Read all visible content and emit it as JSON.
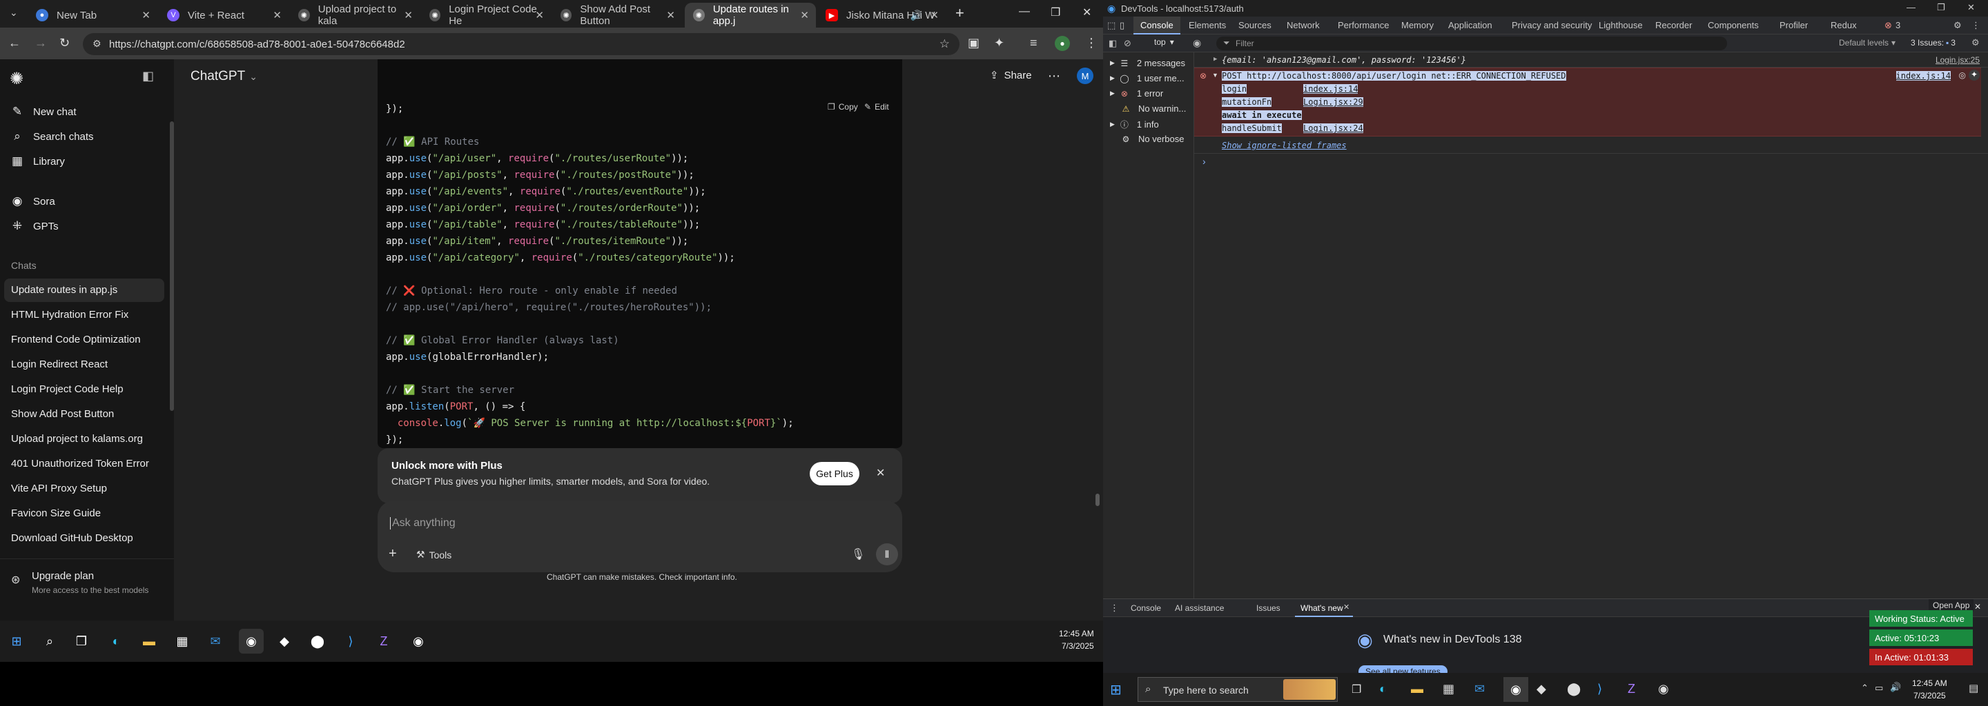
{
  "browser": {
    "tabs": [
      {
        "title": "New Tab",
        "fav": "chrome"
      },
      {
        "title": "Vite + React",
        "fav": "vite"
      },
      {
        "title": "Upload project to kala",
        "fav": "chatgpt"
      },
      {
        "title": "Login Project Code He",
        "fav": "chatgpt"
      },
      {
        "title": "Show Add Post Button",
        "fav": "chatgpt"
      },
      {
        "title": "Update routes in app.j",
        "fav": "chatgpt"
      },
      {
        "title": "Jisko Mitana Hai W",
        "fav": "youtube"
      }
    ],
    "new_tab": "+",
    "url": "https://chatgpt.com/c/68658508-ad78-8001-a0e1-50478c6648d2"
  },
  "sidebar": {
    "new_chat": "New chat",
    "search_chats": "Search chats",
    "library": "Library",
    "sora": "Sora",
    "gpts": "GPTs",
    "chats_heading": "Chats",
    "chats": [
      "Update routes in app.js",
      "HTML Hydration Error Fix",
      "Frontend Code Optimization",
      "Login Redirect React",
      "Login Project Code Help",
      "Show Add Post Button",
      "Upload project to kalams.org",
      "401 Unauthorized Token Error",
      "Vite API Proxy Setup",
      "Favicon Size Guide",
      "Download GitHub Desktop"
    ],
    "upgrade_title": "Upgrade plan",
    "upgrade_sub": "More access to the best models"
  },
  "header": {
    "model": "ChatGPT",
    "share": "Share",
    "avatar": "M"
  },
  "code": {
    "copy": "Copy",
    "edit": "Edit",
    "lines": [
      "});",
      "",
      "// ✅ API Routes",
      "app.use(\"/api/user\", require(\"./routes/userRoute\"));",
      "app.use(\"/api/posts\", require(\"./routes/postRoute\"));",
      "app.use(\"/api/events\", require(\"./routes/eventRoute\"));",
      "app.use(\"/api/order\", require(\"./routes/orderRoute\"));",
      "app.use(\"/api/table\", require(\"./routes/tableRoute\"));",
      "app.use(\"/api/item\", require(\"./routes/itemRoute\"));",
      "app.use(\"/api/category\", require(\"./routes/categoryRoute\"));",
      "",
      "// ❌ Optional: Hero route - only enable if needed",
      "// app.use(\"/api/hero\", require(\"./routes/heroRoutes\"));",
      "",
      "// ✅ Global Error Handler (always last)",
      "app.use(globalErrorHandler);",
      "",
      "// ✅ Start the server",
      "app.listen(PORT, () => {",
      "  console.log(`🚀 POS Server is running at http://localhost:${PORT}`);",
      "});"
    ]
  },
  "upsell": {
    "title": "Unlock more with Plus",
    "subtitle": "ChatGPT Plus gives you higher limits, smarter models, and Sora for video.",
    "button": "Get Plus"
  },
  "composer": {
    "placeholder": "Ask anything",
    "tools": "Tools",
    "disclaimer": "ChatGPT can make mistakes. Check important info."
  },
  "taskbar_left": {
    "time": "12:45 AM",
    "date": "7/3/2025"
  },
  "devtools": {
    "title": "DevTools - localhost:5173/auth",
    "tabs": [
      "Elements",
      "Console",
      "Sources",
      "Network",
      "Performance",
      "Memory",
      "Application",
      "Privacy and security",
      "Lighthouse",
      "Recorder",
      "Components",
      "Profiler",
      "Redux"
    ],
    "active_tab": "Console",
    "issues_badge": "3",
    "context": "top",
    "filter_placeholder": "Filter",
    "levels": "Default levels",
    "issues_label": "3 Issues:",
    "issues_count": "3",
    "sidebar": [
      {
        "icon": "list",
        "label": "2 messages"
      },
      {
        "icon": "user",
        "label": "1 user me..."
      },
      {
        "icon": "error",
        "label": "1 error"
      },
      {
        "icon": "warning",
        "label": "No warnin..."
      },
      {
        "icon": "info",
        "label": "1 info"
      },
      {
        "icon": "verbose",
        "label": "No verbose"
      }
    ],
    "console": {
      "obj_line": "{email: 'ahsan123@gmail.com', password: '123456'}",
      "obj_src": "Login.jsx:25",
      "error_line": "POST http://localhost:8000/api/user/login net::ERR_CONNECTION_REFUSED",
      "error_src": "index.js:14",
      "stack": [
        {
          "fn": "login",
          "src": "index.js:14"
        },
        {
          "fn": "mutationFn",
          "src": "Login.jsx:29"
        },
        {
          "fn": "await in execute",
          "src": ""
        },
        {
          "fn": "handleSubmit",
          "src": "Login.jsx:24"
        }
      ],
      "ignore_listed": "Show ignore-listed frames",
      "prompt": "›"
    },
    "drawer": {
      "tabs": [
        "Console",
        "AI assistance",
        "Issues",
        "What's new"
      ],
      "active": "What's new",
      "headline": "What's new in DevTools 138",
      "see_all": "See all new features",
      "open_app": "Open App"
    },
    "status": {
      "working": "Working Status: Active",
      "active": "Active: 05:10:23",
      "inactive": "In Active: 01:01:33"
    },
    "taskbar": {
      "search": "Type here to search",
      "time": "12:45 AM",
      "date": "7/3/2025"
    }
  },
  "colors": {
    "accent": "#10a37f",
    "error_bg": "#4e2626",
    "status_green": "#1a8a3f",
    "status_red": "#b8201f"
  }
}
